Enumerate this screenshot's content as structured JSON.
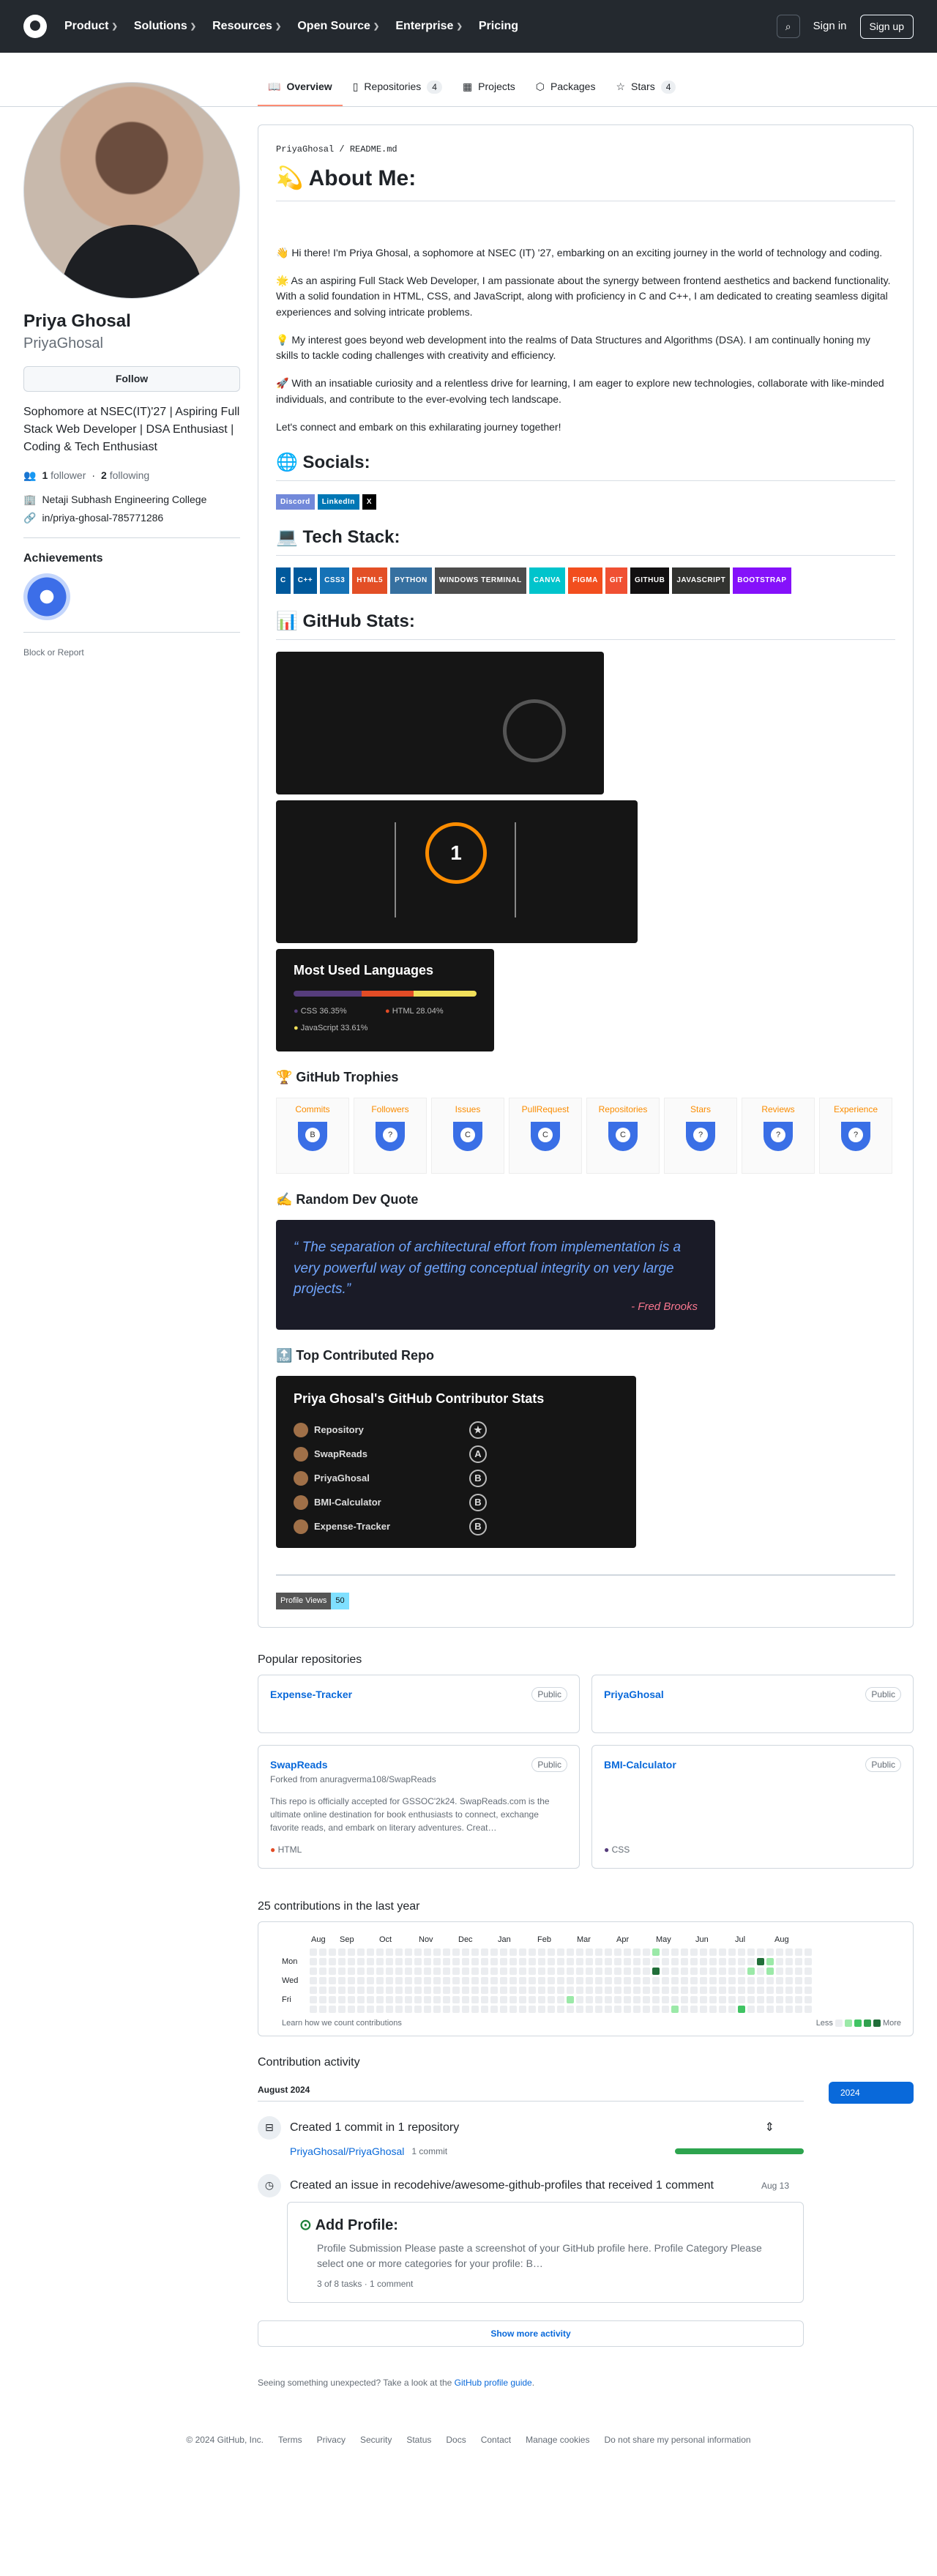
{
  "header": {
    "nav": [
      "Product",
      "Solutions",
      "Resources",
      "Open Source",
      "Enterprise",
      "Pricing"
    ],
    "sign_in": "Sign in",
    "sign_up": "Sign up"
  },
  "tabs": [
    {
      "label": "Overview",
      "count": ""
    },
    {
      "label": "Repositories",
      "count": "4"
    },
    {
      "label": "Projects",
      "count": ""
    },
    {
      "label": "Packages",
      "count": ""
    },
    {
      "label": "Stars",
      "count": "4"
    }
  ],
  "profile": {
    "name": "Priya Ghosal",
    "login": "PriyaGhosal",
    "follow": "Follow",
    "bio": "Sophomore at NSEC(IT)'27 | Aspiring Full Stack Web Developer | DSA Enthusiast | Coding & Tech Enthusiast",
    "followers": "1",
    "followers_label": "follower",
    "following": "2",
    "following_label": "following",
    "org": "Netaji Subhash Engineering College",
    "linkedin": "in/priya-ghosal-785771286",
    "achievements": "Achievements",
    "block": "Block or Report"
  },
  "readme": {
    "path": "PriyaGhosal / README.md",
    "about": "💫 About Me:",
    "p1": "👋 Hi there! I'm Priya Ghosal, a sophomore at NSEC (IT) '27, embarking on an exciting journey in the world of technology and coding.",
    "p2": "🌟 As an aspiring Full Stack Web Developer, I am passionate about the synergy between frontend aesthetics and backend functionality. With a solid foundation in HTML, CSS, and JavaScript, along with proficiency in C and C++, I am dedicated to creating seamless digital experiences and solving intricate problems.",
    "p3": "💡 My interest goes beyond web development into the realms of Data Structures and Algorithms (DSA). I am continually honing my skills to tackle coding challenges with creativity and efficiency.",
    "p4": "🚀 With an insatiable curiosity and a relentless drive for learning, I am eager to explore new technologies, collaborate with like-minded individuals, and contribute to the ever-evolving tech landscape.",
    "p5": "Let's connect and embark on this exhilarating journey together!",
    "socials": "🌐 Socials:",
    "social_badges": [
      "Discord",
      "LinkedIn",
      "X"
    ],
    "tech": "💻 Tech Stack:",
    "tech_badges": [
      {
        "t": "C",
        "c": "#00599C"
      },
      {
        "t": "C++",
        "c": "#00599C"
      },
      {
        "t": "CSS3",
        "c": "#1572B6"
      },
      {
        "t": "HTML5",
        "c": "#E34F26"
      },
      {
        "t": "PYTHON",
        "c": "#3670A0"
      },
      {
        "t": "WINDOWS TERMINAL",
        "c": "#4D4D4D"
      },
      {
        "t": "CANVA",
        "c": "#00C4CC"
      },
      {
        "t": "FIGMA",
        "c": "#F24E1E"
      },
      {
        "t": "GIT",
        "c": "#F05033"
      },
      {
        "t": "GITHUB",
        "c": "#121011"
      },
      {
        "t": "JAVASCRIPT",
        "c": "#323330"
      },
      {
        "t": "BOOTSTRAP",
        "c": "#8511FA"
      }
    ],
    "stats": "📊 GitHub Stats:",
    "streak_value": "1",
    "langs_title": "Most Used Languages",
    "langs": [
      {
        "name": "CSS",
        "pct": "36.35%",
        "c": "#563d7c"
      },
      {
        "name": "HTML",
        "pct": "28.04%",
        "c": "#e34c26"
      },
      {
        "name": "JavaScript",
        "pct": "33.61%",
        "c": "#f1e05a"
      }
    ],
    "trophies_h": "🏆 GitHub Trophies",
    "trophies": [
      {
        "n": "Commits",
        "g": "B"
      },
      {
        "n": "Followers",
        "g": "?"
      },
      {
        "n": "Issues",
        "g": "C"
      },
      {
        "n": "PullRequest",
        "g": "C"
      },
      {
        "n": "Repositories",
        "g": "C"
      },
      {
        "n": "Stars",
        "g": "?"
      },
      {
        "n": "Reviews",
        "g": "?"
      },
      {
        "n": "Experience",
        "g": "?"
      }
    ],
    "quote_h": "✍️ Random Dev Quote",
    "quote": "“ The separation of architectural effort from implementation is a very powerful way of getting conceptual integrity on very large projects.”",
    "quote_author": "- Fred Brooks",
    "top_h": "🔝 Top Contributed Repo",
    "contrib_title": "Priya Ghosal's GitHub Contributor Stats",
    "contrib_rows": [
      {
        "n": "Repository",
        "g": "★"
      },
      {
        "n": "SwapReads",
        "g": "A"
      },
      {
        "n": "PriyaGhosal",
        "g": "B"
      },
      {
        "n": "BMI-Calculator",
        "g": "B"
      },
      {
        "n": "Expense-Tracker",
        "g": "B"
      }
    ],
    "pv_label": "Profile Views",
    "pv_count": "50"
  },
  "popular": {
    "title": "Popular repositories",
    "public": "Public",
    "repos": [
      {
        "name": "Expense-Tracker",
        "fork": "",
        "desc": "",
        "lang": "",
        "c": ""
      },
      {
        "name": "PriyaGhosal",
        "fork": "",
        "desc": "",
        "lang": "",
        "c": ""
      },
      {
        "name": "SwapReads",
        "fork": "Forked from anuragverma108/SwapReads",
        "desc": "This repo is officially accepted for GSSOC'2k24. SwapReads.com is the ultimate online destination for book enthusiasts to connect, exchange favorite reads, and embark on literary adventures. Creat…",
        "lang": "HTML",
        "c": "#e34c26"
      },
      {
        "name": "BMI-Calculator",
        "fork": "",
        "desc": "",
        "lang": "CSS",
        "c": "#563d7c"
      }
    ]
  },
  "calendar": {
    "title": "25 contributions in the last year",
    "months": [
      "Aug",
      "Sep",
      "Oct",
      "Nov",
      "Dec",
      "Jan",
      "Feb",
      "Mar",
      "Apr",
      "May",
      "Jun",
      "Jul",
      "Aug"
    ],
    "days": [
      "Mon",
      "Wed",
      "Fri"
    ],
    "learn": "Learn how we count contributions",
    "less": "Less",
    "more": "More"
  },
  "activity": {
    "title": "Contribution activity",
    "year": "2024",
    "month": "August 2024",
    "ev1": "Created 1 commit in 1 repository",
    "ev1_repo": "PriyaGhosal/PriyaGhosal",
    "ev1_count": "1 commit",
    "ev2": "Created an issue in recodehive/awesome-github-profiles that received 1 comment",
    "ev2_date": "Aug 13",
    "issue_title": "Add Profile:",
    "issue_body": "Profile Submission Please paste a screenshot of your GitHub profile here. Profile Category Please select one or more categories for your profile: B…",
    "issue_meta": "3 of 8 tasks · 1 comment",
    "show_more": "Show more activity",
    "unexpected": "Seeing something unexpected? Take a look at the",
    "guide": "GitHub profile guide"
  },
  "footer": [
    "© 2024 GitHub, Inc.",
    "Terms",
    "Privacy",
    "Security",
    "Status",
    "Docs",
    "Contact",
    "Manage cookies",
    "Do not share my personal information"
  ]
}
